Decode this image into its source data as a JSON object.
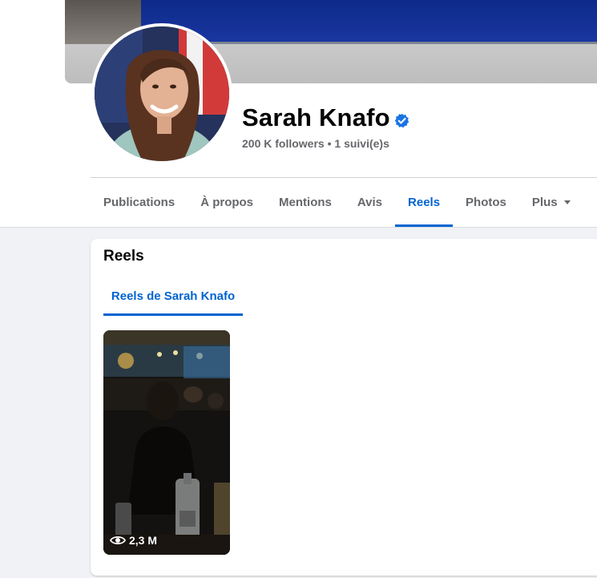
{
  "profile": {
    "name": "Sarah Knafo",
    "followers": "200 K followers",
    "separator": "•",
    "following": "1 suivi(e)s"
  },
  "tabs": [
    {
      "label": "Publications",
      "active": false
    },
    {
      "label": "À propos",
      "active": false
    },
    {
      "label": "Mentions",
      "active": false
    },
    {
      "label": "Avis",
      "active": false
    },
    {
      "label": "Reels",
      "active": true
    },
    {
      "label": "Photos",
      "active": false
    },
    {
      "label": "Plus",
      "active": false
    }
  ],
  "reels": {
    "title": "Reels",
    "subtab": "Reels de Sarah Knafo",
    "items": [
      {
        "views": "2,3 M"
      }
    ]
  },
  "colors": {
    "accent": "#0064d1",
    "verified": "#1b74e4",
    "secondary_text": "#65676b",
    "background": "#f0f2f5"
  },
  "icons": {
    "verified": "verified-badge-icon",
    "views": "eye-icon",
    "more": "caret-down-icon"
  }
}
